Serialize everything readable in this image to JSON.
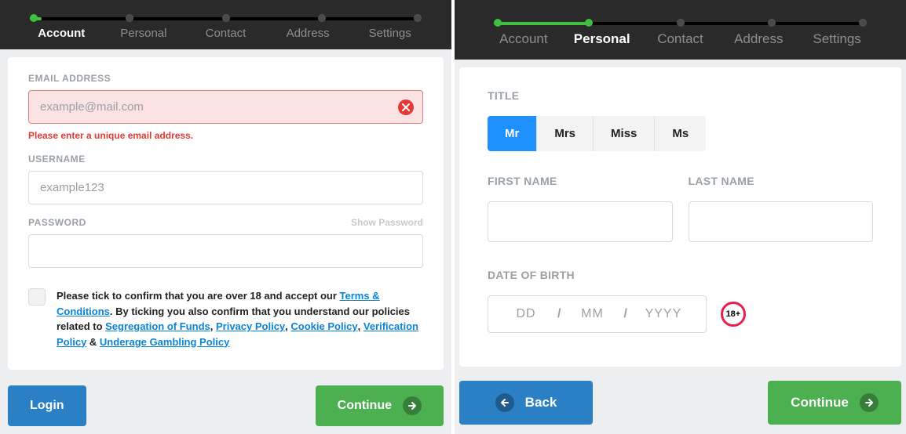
{
  "steps": [
    "Account",
    "Personal",
    "Contact",
    "Address",
    "Settings"
  ],
  "left": {
    "activeStep": 0,
    "email": {
      "label": "EMAIL ADDRESS",
      "placeholder": "example@mail.com",
      "error": "Please enter a unique email address."
    },
    "username": {
      "label": "USERNAME",
      "placeholder": "example123"
    },
    "password": {
      "label": "PASSWORD",
      "show": "Show Password"
    },
    "consent": {
      "lead": "Please tick to confirm that you are over 18 and accept our ",
      "tnc": "Terms & Conditions",
      "mid": ". By ticking you also confirm that you understand our policies related to ",
      "seg": "Segregation of Funds",
      "sep1": ", ",
      "privacy": "Privacy Policy",
      "sep2": ", ",
      "cookie": "Cookie Policy",
      "sep3": ", ",
      "verify": "Verification Policy",
      "amp": " & ",
      "underage": "Underage Gambling Policy"
    },
    "login": "Login",
    "continue": "Continue"
  },
  "right": {
    "activeStep": 1,
    "titleLabel": "TITLE",
    "titles": [
      "Mr",
      "Mrs",
      "Miss",
      "Ms"
    ],
    "selectedTitle": "Mr",
    "firstName": "FIRST NAME",
    "lastName": "LAST NAME",
    "dobLabel": "DATE OF BIRTH",
    "dob": {
      "dd": "DD",
      "mm": "MM",
      "yyyy": "YYYY"
    },
    "badge": "18+",
    "back": "Back",
    "continue": "Continue"
  }
}
